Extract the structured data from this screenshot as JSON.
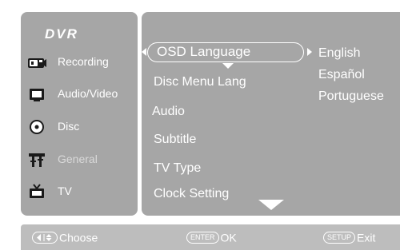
{
  "sidebar": {
    "title": "DVR",
    "items": [
      {
        "label": "Recording",
        "icon": "camera-icon"
      },
      {
        "label": "Audio/Video",
        "icon": "monitor-icon"
      },
      {
        "label": "Disc",
        "icon": "disc-icon"
      },
      {
        "label": "General",
        "icon": "tools-icon",
        "dimmed": true
      },
      {
        "label": "TV",
        "icon": "tv-icon"
      }
    ]
  },
  "menu": {
    "selected": "OSD Language",
    "items": [
      "Disc Menu Lang",
      "Audio",
      "Subtitle",
      "TV Type",
      "Clock Setting"
    ],
    "options": [
      "English",
      "Español",
      "Portuguese"
    ]
  },
  "footer": {
    "choose": {
      "label": "Choose"
    },
    "ok": {
      "key": "ENTER",
      "label": "OK"
    },
    "exit": {
      "key": "SETUP",
      "label": "Exit"
    }
  },
  "colors": {
    "panel": "#a6a6a6",
    "footer": "#bdbdbd",
    "text": "#ffffff",
    "dimmed_text": "#d9d9d9"
  }
}
